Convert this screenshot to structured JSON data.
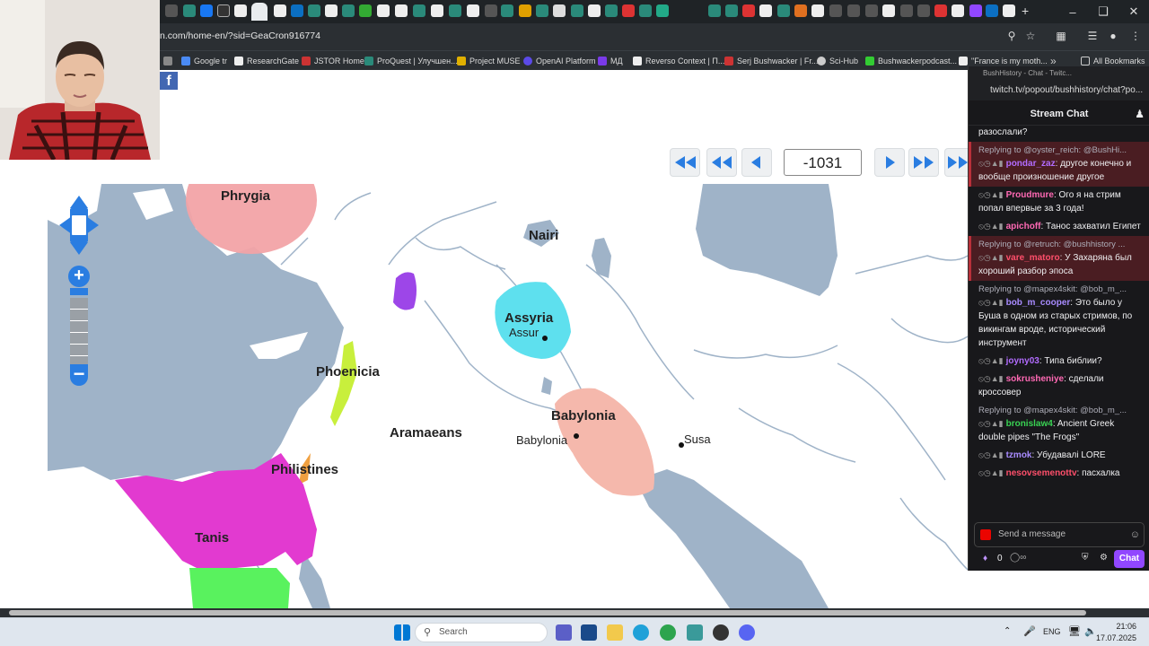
{
  "browser": {
    "url": "n.com/home-en/?sid=GeaCron916774",
    "bookmarks": [
      "Google tr",
      "ResearchGate",
      "JSTOR Home",
      "ProQuest | Улучшен...",
      "Project MUSE",
      "OpenAI Platform",
      "МД",
      "Reverso Context | П...",
      "Serj Bushwacker | Fr...",
      "Sci-Hub",
      "Bushwackerpodcast...",
      "\"France is my moth...",
      "All Bookmarks"
    ]
  },
  "timeline": {
    "year": "-1031"
  },
  "map": {
    "regions": {
      "phrygia": "Phrygia",
      "nairi": "Nairi",
      "assyria": "Assyria",
      "phoenicia": "Phoenicia",
      "aramaeans": "Aramaeans",
      "babylonia": "Babylonia",
      "philistines": "Philistines",
      "tanis": "Tanis"
    },
    "cities": {
      "assur": "Assur",
      "babylonia_city": "Babylonia",
      "susa": "Susa"
    },
    "colors": {
      "water": "#9fb3c8",
      "land": "#ffffff",
      "phrygia": "#f2a3a6",
      "assyria": "#5ee0ee",
      "babylonia": "#f5b8ac",
      "phoenicia": "#c8ef3c",
      "tanis": "#e23ad0",
      "purple": "#9d46e8",
      "green": "#59f25e",
      "philistines": "#f0a040"
    }
  },
  "chat": {
    "window_title": "BushHistory - Chat - Twitc...",
    "url": "twitch.tv/popout/bushhistory/chat?po...",
    "header": "Stream Chat",
    "top_fragment": "разослали?",
    "messages": [
      {
        "reply": "Replying to @oyster_reich: @BushHi...",
        "user": "pondar_zaz",
        "color": "#b26cff",
        "text": ": другое конечно и вообще произношение другое",
        "highlight": true
      },
      {
        "reply": "",
        "user": "Proudmure",
        "color": "#ff69b4",
        "text": ": Ого я на стрим попал впервые за 3 года!",
        "highlight": false
      },
      {
        "reply": "",
        "user": "apichoff",
        "color": "#ff69b4",
        "text": ": Танос захватил Египет",
        "highlight": false
      },
      {
        "reply": "Replying to @retruch: @bushhistory ...",
        "user": "vare_matoro",
        "color": "#ff4f6b",
        "text": ": У Захаряна был хороший разбор эпоса",
        "highlight": true
      },
      {
        "reply": "Replying to @mapex4skit: @bob_m_...",
        "user": "bob_m_cooper",
        "color": "#a88bff",
        "text": ": Это было у Буша в одном из старых стримов, по викингам вроде, исторический инструмент",
        "highlight": false
      },
      {
        "reply": "",
        "user": "joyny03",
        "color": "#b26cff",
        "text": ": Типа библии?",
        "highlight": false
      },
      {
        "reply": "",
        "user": "sokrusheniye",
        "color": "#ff69b4",
        "text": ": сделали кроссовер",
        "highlight": false
      },
      {
        "reply": "Replying to @mapex4skit: @bob_m_...",
        "user": "bronislaw4",
        "color": "#39d353",
        "text": ": Ancient Greek double pipes \"The Frogs\"",
        "highlight": false
      },
      {
        "reply": "",
        "user": "tzmok",
        "color": "#a88bff",
        "text": ": Убудавалі LORE",
        "highlight": false
      },
      {
        "reply": "",
        "user": "nesovsemenottv",
        "color": "#ff4f6b",
        "text": ": пасхалка",
        "highlight": false
      }
    ],
    "input_placeholder": "Send a message",
    "points": "0",
    "chat_button": "Chat"
  },
  "taskbar": {
    "search": "Search",
    "lang": "ENG",
    "time": "21:06",
    "date": "17.07.2025"
  }
}
